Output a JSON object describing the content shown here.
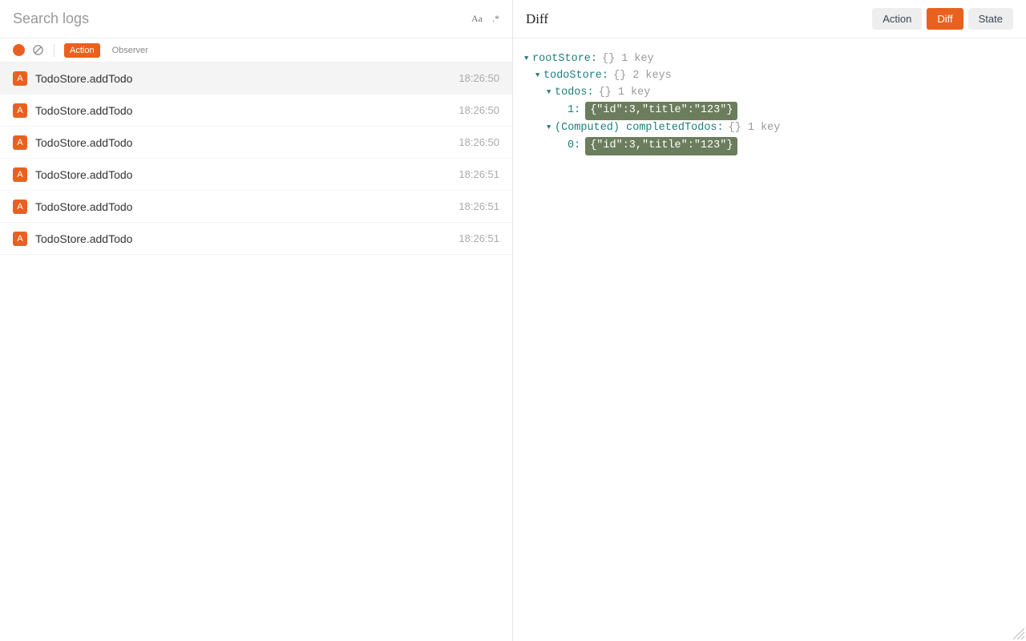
{
  "search": {
    "placeholder": "Search logs",
    "case_label": "Aa",
    "regex_label": ".*"
  },
  "filters": {
    "action_label": "Action",
    "observer_label": "Observer"
  },
  "logs": [
    {
      "badge": "A",
      "name": "TodoStore.addTodo",
      "time": "18:26:50",
      "selected": true
    },
    {
      "badge": "A",
      "name": "TodoStore.addTodo",
      "time": "18:26:50",
      "selected": false
    },
    {
      "badge": "A",
      "name": "TodoStore.addTodo",
      "time": "18:26:50",
      "selected": false
    },
    {
      "badge": "A",
      "name": "TodoStore.addTodo",
      "time": "18:26:51",
      "selected": false
    },
    {
      "badge": "A",
      "name": "TodoStore.addTodo",
      "time": "18:26:51",
      "selected": false
    },
    {
      "badge": "A",
      "name": "TodoStore.addTodo",
      "time": "18:26:51",
      "selected": false
    }
  ],
  "right": {
    "title": "Diff",
    "tabs": {
      "action": "Action",
      "diff": "Diff",
      "state": "State"
    },
    "tree": {
      "root_key": "rootStore:",
      "root_braces": "{}",
      "root_meta": "1 key",
      "todoStore_key": "todoStore:",
      "todoStore_braces": "{}",
      "todoStore_meta": "2 keys",
      "todos_key": "todos:",
      "todos_braces": "{}",
      "todos_meta": "1 key",
      "todos_item_key": "1:",
      "todos_item_val": "{\"id\":3,\"title\":\"123\"}",
      "computed_key": "(Computed) completedTodos:",
      "computed_braces": "{}",
      "computed_meta": "1 key",
      "computed_item_key": "0:",
      "computed_item_val": "{\"id\":3,\"title\":\"123\"}"
    }
  }
}
